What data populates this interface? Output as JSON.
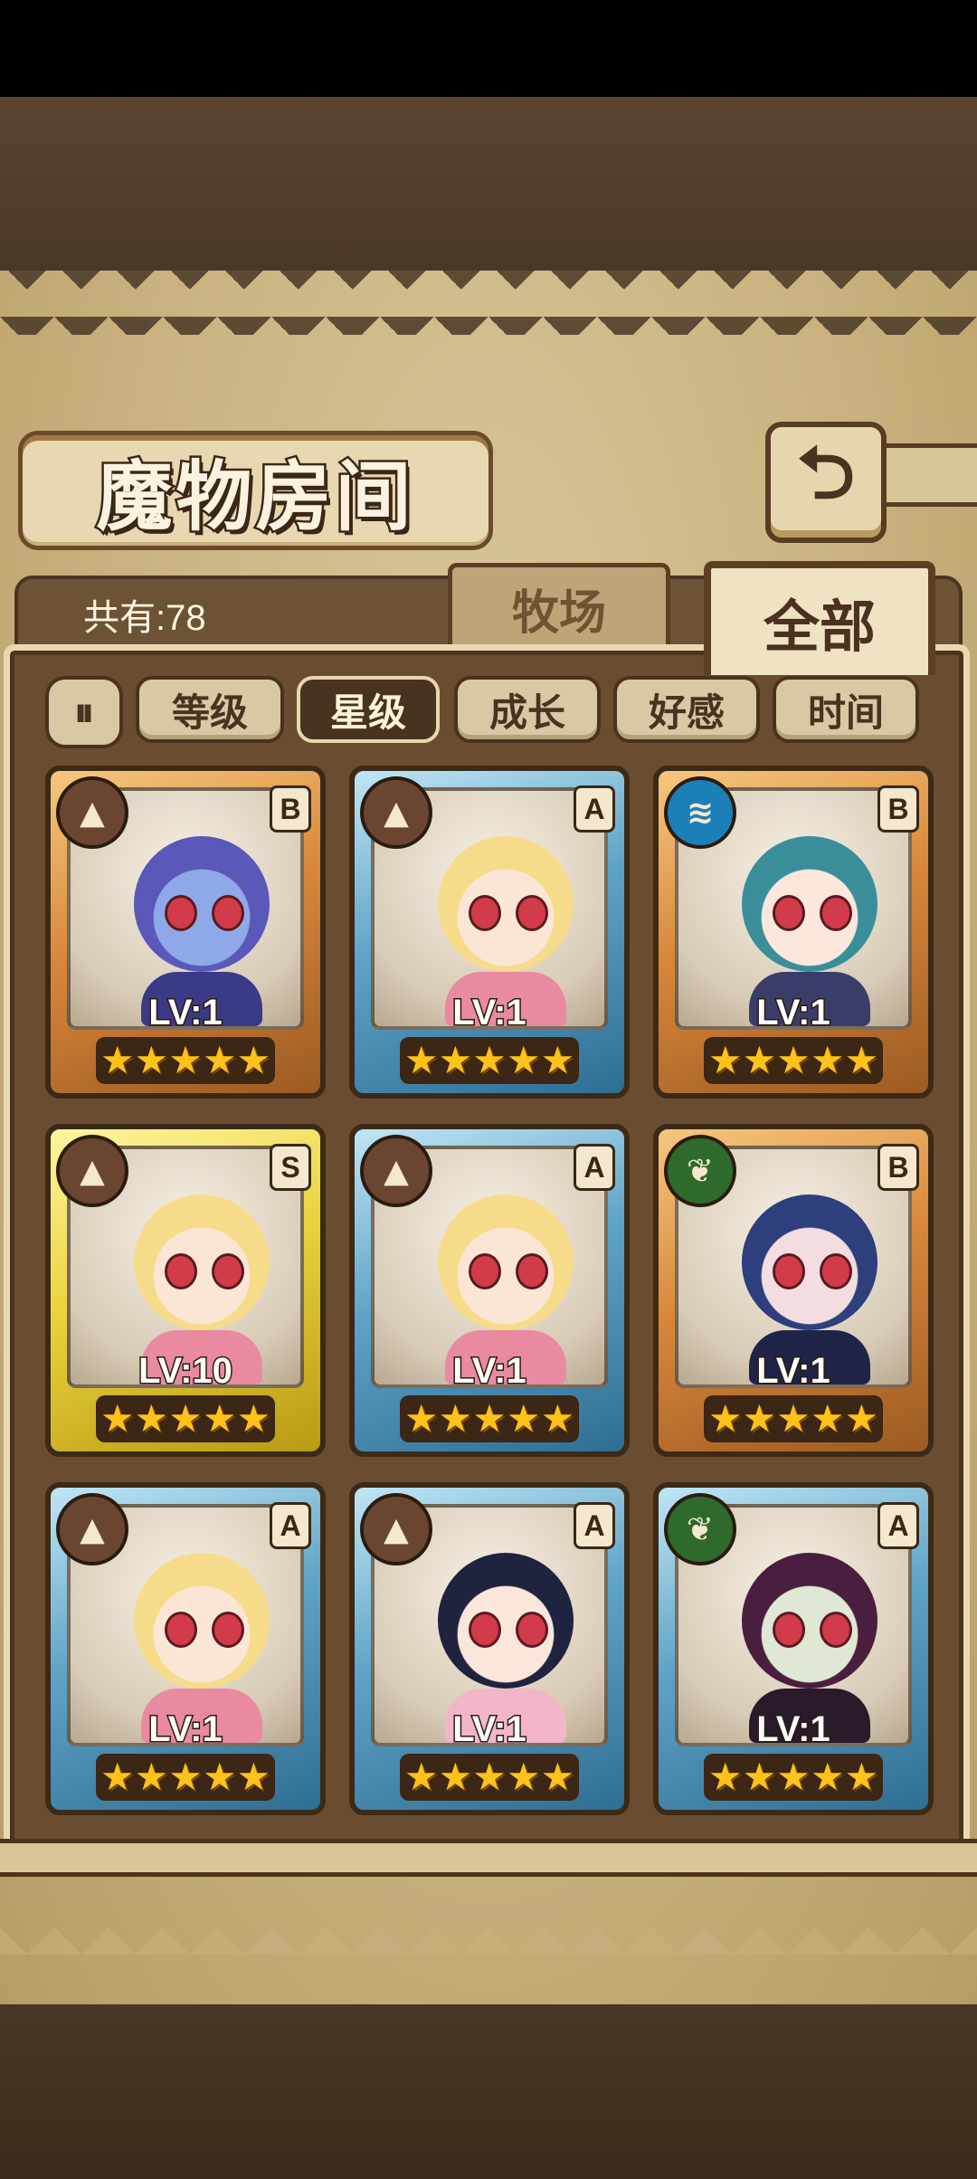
{
  "title": "魔物房间",
  "count_label": "共有:78",
  "tabs": [
    {
      "label": "牧场",
      "active": false
    },
    {
      "label": "全部",
      "active": true
    }
  ],
  "sort_buttons": [
    {
      "label": "等级",
      "active": false
    },
    {
      "label": "星级",
      "active": true
    },
    {
      "label": "成长",
      "active": false
    },
    {
      "label": "好感",
      "active": false
    },
    {
      "label": "时间",
      "active": false
    }
  ],
  "back_icon": "return-icon",
  "cards": [
    {
      "element": "earth",
      "rarity": "B",
      "level": "LV:1",
      "stars": 5,
      "frame": "orange",
      "hair": "#5a58b8",
      "skin": "#8fa9e8",
      "outfit": "#3b3a86"
    },
    {
      "element": "earth",
      "rarity": "A",
      "level": "LV:1",
      "stars": 5,
      "frame": "blue",
      "hair": "#f6dc8a",
      "skin": "#fbe6d6",
      "outfit": "#e98aa0"
    },
    {
      "element": "water",
      "rarity": "B",
      "level": "LV:1",
      "stars": 5,
      "frame": "orange",
      "hair": "#3a8e9a",
      "skin": "#fbe7dc",
      "outfit": "#3a3d6a"
    },
    {
      "element": "earth",
      "rarity": "S",
      "level": "LV:10",
      "stars": 5,
      "frame": "gold",
      "hair": "#f6dc8a",
      "skin": "#fbe6d6",
      "outfit": "#e98aa0"
    },
    {
      "element": "earth",
      "rarity": "A",
      "level": "LV:1",
      "stars": 5,
      "frame": "blue",
      "hair": "#f6dc8a",
      "skin": "#fbe6d6",
      "outfit": "#e98aa0"
    },
    {
      "element": "wood",
      "rarity": "B",
      "level": "LV:1",
      "stars": 5,
      "frame": "orange",
      "hair": "#2d3f7c",
      "skin": "#f2dde0",
      "outfit": "#1f2348"
    },
    {
      "element": "earth",
      "rarity": "A",
      "level": "LV:1",
      "stars": 5,
      "frame": "blue",
      "hair": "#f6dc8a",
      "skin": "#fbe6d6",
      "outfit": "#e98aa0"
    },
    {
      "element": "earth",
      "rarity": "A",
      "level": "LV:1",
      "stars": 5,
      "frame": "blue",
      "hair": "#20233f",
      "skin": "#fbe6dc",
      "outfit": "#f3b6c8"
    },
    {
      "element": "wood",
      "rarity": "A",
      "level": "LV:1",
      "stars": 5,
      "frame": "blue",
      "hair": "#4a1e3e",
      "skin": "#dfe8d4",
      "outfit": "#2a1a2a"
    }
  ]
}
